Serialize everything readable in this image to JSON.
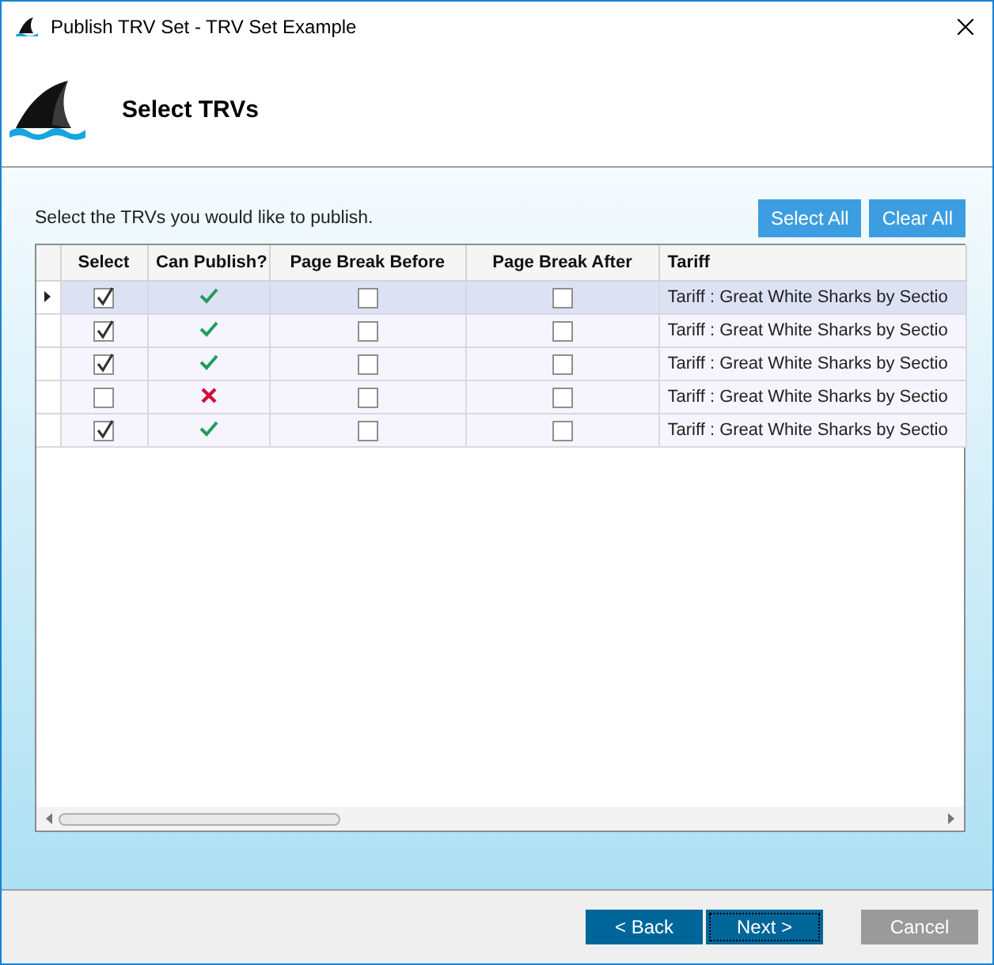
{
  "window": {
    "title": "Publish TRV Set - TRV Set Example"
  },
  "header": {
    "title": "Select TRVs"
  },
  "instruction": "Select the TRVs you would like to publish.",
  "actions": [
    {
      "label": "Select All"
    },
    {
      "label": "Clear All"
    }
  ],
  "table": {
    "columns": [
      "Select",
      "Can Publish?",
      "Page Break Before",
      "Page Break After",
      "Tariff"
    ],
    "rows": [
      {
        "selected": true,
        "select": true,
        "can_publish": true,
        "page_break_before": false,
        "page_break_after": false,
        "tariff": "Tariff : Great White Sharks by Sectio"
      },
      {
        "selected": false,
        "select": true,
        "can_publish": true,
        "page_break_before": false,
        "page_break_after": false,
        "tariff": "Tariff : Great White Sharks by Sectio"
      },
      {
        "selected": false,
        "select": true,
        "can_publish": true,
        "page_break_before": false,
        "page_break_after": false,
        "tariff": "Tariff : Great White Sharks by Sectio"
      },
      {
        "selected": false,
        "select": false,
        "can_publish": false,
        "page_break_before": false,
        "page_break_after": false,
        "tariff": "Tariff : Great White Sharks by Sectio"
      },
      {
        "selected": false,
        "select": true,
        "can_publish": true,
        "page_break_before": false,
        "page_break_after": false,
        "tariff": "Tariff : Great White Sharks by Sectio"
      }
    ]
  },
  "buttons": [
    {
      "label": "< Back",
      "disabled": false
    },
    {
      "label": "Next >",
      "disabled": false
    },
    {
      "label": "Cancel",
      "disabled": true
    }
  ]
}
